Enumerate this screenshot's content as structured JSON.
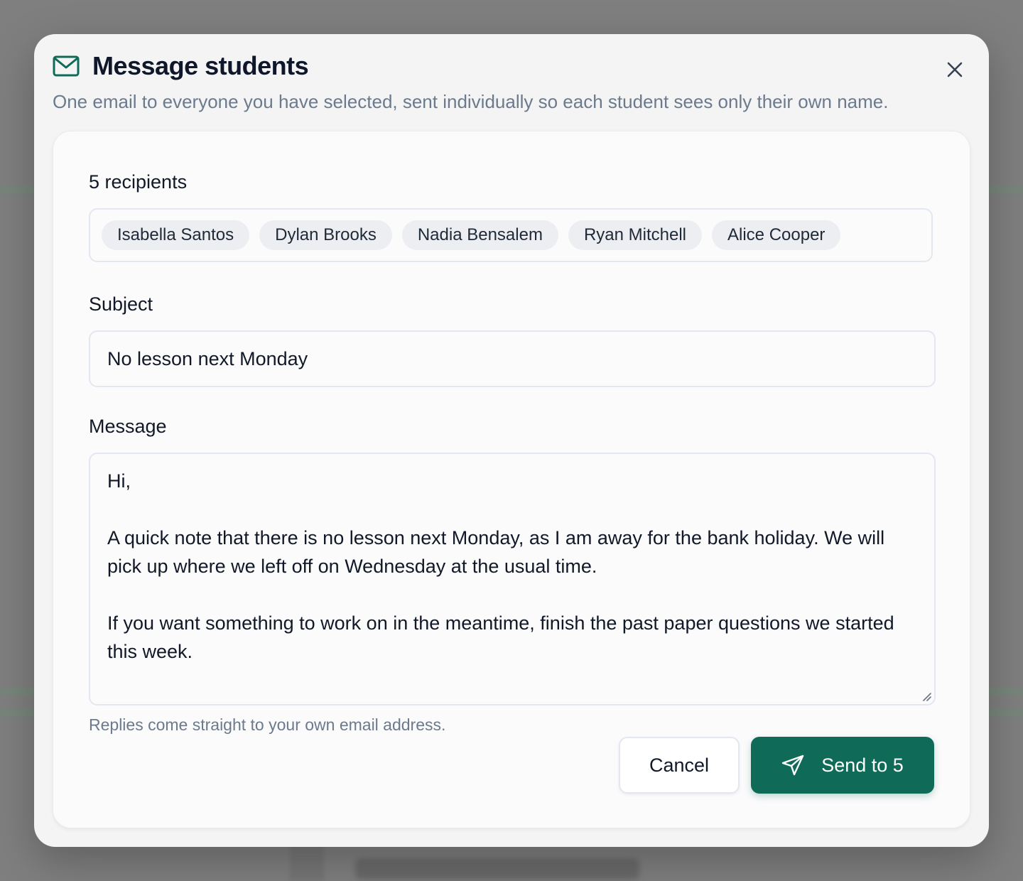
{
  "modal": {
    "title": "Message students",
    "subtitle": "One email to everyone you have selected, sent individually so each student sees only their own name.",
    "icon": "mail-icon",
    "close_icon": "close-icon"
  },
  "recipients": {
    "label": "5 recipients",
    "chips": [
      "Isabella Santos",
      "Dylan Brooks",
      "Nadia Bensalem",
      "Ryan Mitchell",
      "Alice Cooper"
    ]
  },
  "subject": {
    "label": "Subject",
    "value": "No lesson next Monday"
  },
  "message": {
    "label": "Message",
    "value": "Hi,\n\nA quick note that there is no lesson next Monday, as I am away for the bank holiday. We will pick up where we left off on Wednesday at the usual time.\n\nIf you want something to work on in the meantime, finish the past paper questions we started this week."
  },
  "footer": {
    "hint": "Replies come straight to your own email address.",
    "cancel_label": "Cancel",
    "send_label": "Send to 5",
    "send_icon": "send-icon"
  },
  "colors": {
    "accent": "#0f6b57",
    "muted_text": "#6b7a8c",
    "title_text": "#0f172a"
  }
}
